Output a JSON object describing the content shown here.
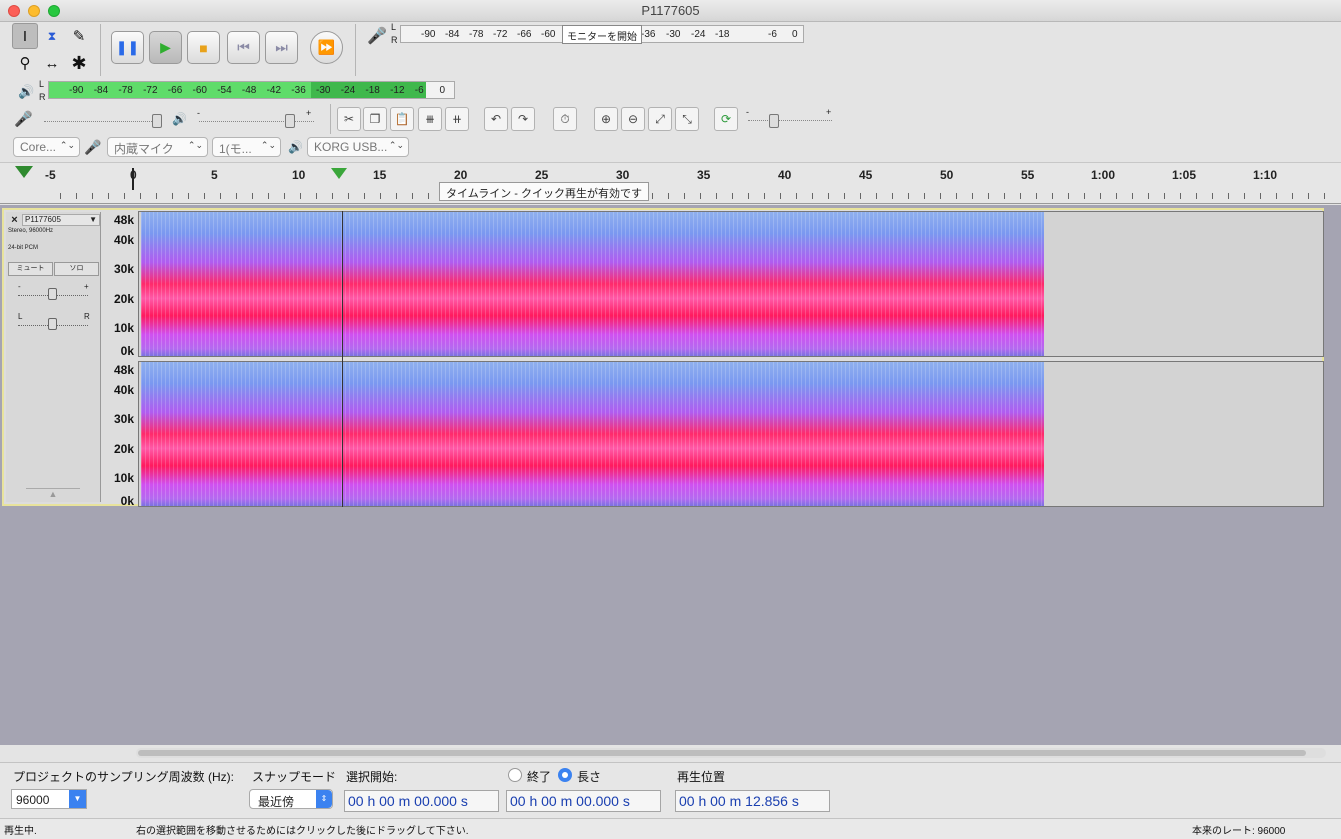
{
  "window": {
    "title": "P1177605"
  },
  "toolbar": {
    "record_meter_ticks": [
      "-90",
      "-84",
      "-78",
      "-72",
      "-66",
      "-60",
      "-36",
      "-30",
      "-24",
      "-18",
      "-6",
      "0"
    ],
    "monitor_button": "モニターを開始",
    "play_meter_ticks": [
      "-90",
      "-84",
      "-78",
      "-72",
      "-66",
      "-60",
      "-54",
      "-48",
      "-42",
      "-36",
      "-30",
      "-24",
      "-18",
      "-12",
      "-6",
      "0"
    ],
    "lr": {
      "l": "L",
      "r": "R"
    },
    "slider_minus": "-",
    "slider_plus": "+"
  },
  "device": {
    "host": "Core...",
    "input": "内蔵マイク",
    "channels": "1(モ...",
    "output": "KORG USB..."
  },
  "ruler": {
    "labels": [
      "-5",
      "0",
      "5",
      "10",
      "15",
      "20",
      "25",
      "30",
      "35",
      "40",
      "45",
      "50",
      "55",
      "1:00",
      "1:05",
      "1:10"
    ],
    "tooltip": "タイムライン - クイック再生が有効です"
  },
  "track": {
    "name": "P1177605",
    "info1": "Stereo, 96000Hz",
    "info2": "24-bit PCM",
    "mute": "ミュート",
    "solo": "ソロ",
    "gain_minus": "-",
    "gain_plus": "+",
    "pan_l": "L",
    "pan_r": "R",
    "y_labels": [
      "48k",
      "40k",
      "30k",
      "20k",
      "10k",
      "0k"
    ]
  },
  "bottom": {
    "rate_label": "プロジェクトのサンプリング周波数 (Hz):",
    "rate_value": "96000",
    "snap_label": "スナップモード",
    "snap_value": "最近傍",
    "sel_start_label": "選択開始:",
    "end_label": "終了",
    "length_label": "長さ",
    "pos_label": "再生位置",
    "tc1": "00 h 00 m 00.000 s",
    "tc2": "00 h 00 m 00.000 s",
    "tc3": "00 h 00 m 12.856 s"
  },
  "status": {
    "left": "再生中.",
    "middle": "右の選択範囲を移動させるためにはクリックした後にドラッグして下さい.",
    "right": "本来のレート: 96000"
  },
  "colors": {
    "spectrum_high": "#ff1a5e",
    "spectrum_mid": "#c04bff",
    "spectrum_low": "#7fa6f0",
    "meter_green": "#5fdc6a"
  }
}
